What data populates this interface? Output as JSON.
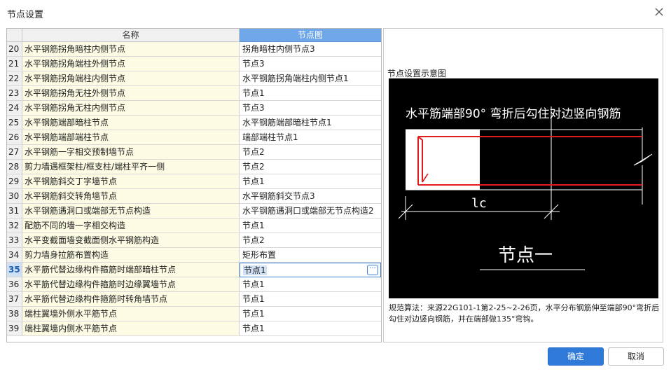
{
  "window": {
    "title": "节点设置",
    "close_icon": "close-icon"
  },
  "table": {
    "headers": {
      "name": "名称",
      "node": "节点图"
    },
    "rows": [
      {
        "num": "20",
        "name": "水平钢筋拐角暗柱内侧节点",
        "node": "拐角暗柱内侧节点3"
      },
      {
        "num": "21",
        "name": "水平钢筋拐角端柱外侧节点",
        "node": "节点3"
      },
      {
        "num": "22",
        "name": "水平钢筋拐角端柱内侧节点",
        "node": "水平钢筋拐角端柱内侧节点1"
      },
      {
        "num": "23",
        "name": "水平钢筋拐角无柱外侧节点",
        "node": "节点1"
      },
      {
        "num": "24",
        "name": "水平钢筋拐角无柱内侧节点",
        "node": "节点3"
      },
      {
        "num": "25",
        "name": "水平钢筋端部暗柱节点",
        "node": "水平钢筋端部暗柱节点1"
      },
      {
        "num": "26",
        "name": "水平钢筋端部端柱节点",
        "node": "端部端柱节点1"
      },
      {
        "num": "27",
        "name": "水平钢筋一字相交预制墙节点",
        "node": "节点2"
      },
      {
        "num": "28",
        "name": "剪力墙遇框架柱/框支柱/端柱平齐一侧",
        "node": "节点2"
      },
      {
        "num": "29",
        "name": "水平钢筋斜交丁字墙节点",
        "node": "节点1"
      },
      {
        "num": "30",
        "name": "水平钢筋斜交转角墙节点",
        "node": "水平钢筋斜交节点3"
      },
      {
        "num": "31",
        "name": "水平钢筋遇洞口或端部无节点构造",
        "node": "水平钢筋遇洞口或端部无节点构造2"
      },
      {
        "num": "32",
        "name": "配筋不同的墙一字相交构造",
        "node": "节点1"
      },
      {
        "num": "33",
        "name": "水平变截面墙变截面侧水平钢筋构造",
        "node": "节点2"
      },
      {
        "num": "34",
        "name": "剪力墙身拉筋布置构造",
        "node": "矩形布置"
      },
      {
        "num": "35",
        "name": "水平筋代替边缘构件箍筋时端部暗柱节点",
        "node": "节点1",
        "selected": true
      },
      {
        "num": "36",
        "name": "水平筋代替边缘构件箍筋时边缘翼墙节点",
        "node": "节点1"
      },
      {
        "num": "37",
        "name": "水平筋代替边缘构件箍筋时转角墙节点",
        "node": "节点1"
      },
      {
        "num": "38",
        "name": "端柱翼墙外侧水平筋节点",
        "node": "节点1"
      },
      {
        "num": "39",
        "name": "端柱翼墙内侧水平筋节点",
        "node": "节点1"
      }
    ],
    "selected_button_glyph": "···"
  },
  "preview": {
    "label": "节点设置示意图",
    "diagram_title": "水平筋端部90° 弯折后勾住对边竖向钢筋",
    "dimension_label": "lc",
    "node_label": "节点一",
    "description": "规范算法：来源22G101-1第2-25~2-26页，水平分布钢筋伸至端部90°弯折后勾住对边竖向钢筋，并在端部做135°弯钩。"
  },
  "buttons": {
    "ok": "确定",
    "cancel": "取消"
  },
  "colors": {
    "accent": "#2f7ad9",
    "header_active": "#6fa7e8",
    "name_cell_bg": "#fdfbe3",
    "rebar": "#e31b1b"
  }
}
